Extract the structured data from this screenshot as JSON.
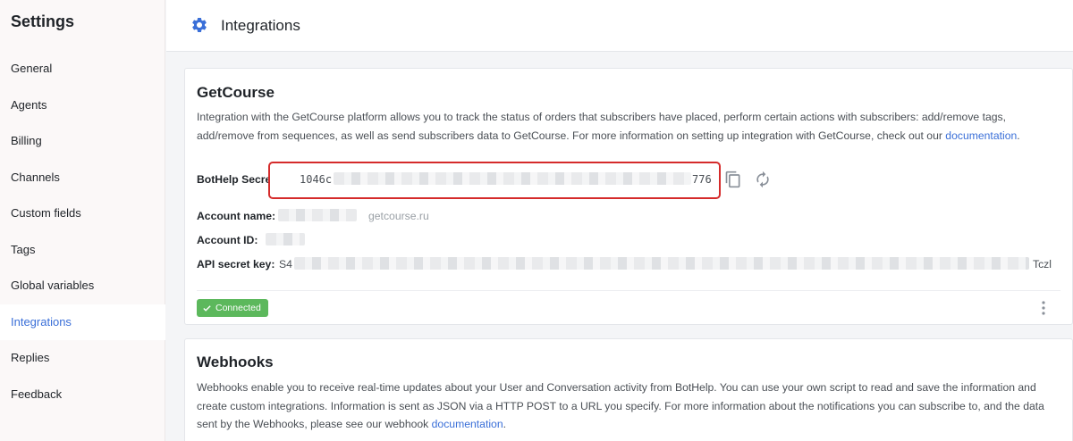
{
  "sidebar": {
    "title": "Settings",
    "items": [
      {
        "label": "General",
        "active": false
      },
      {
        "label": "Agents",
        "active": false
      },
      {
        "label": "Billing",
        "active": false
      },
      {
        "label": "Channels",
        "active": false
      },
      {
        "label": "Custom fields",
        "active": false
      },
      {
        "label": "Tags",
        "active": false
      },
      {
        "label": "Global variables",
        "active": false
      },
      {
        "label": "Integrations",
        "active": true
      },
      {
        "label": "Replies",
        "active": false
      },
      {
        "label": "Feedback",
        "active": false
      }
    ]
  },
  "header": {
    "title": "Integrations",
    "icon": "gear-icon"
  },
  "getcourse": {
    "title": "GetCourse",
    "description": "Integration with the GetCourse platform allows you to track the status of orders that subscribers have placed, perform certain actions with subscribers: add/remove tags, add/remove from sequences, as well as send subscribers data to GetCourse. For more information on setting up integration with GetCourse, check out our ",
    "description_link": "documentation",
    "description_end": ".",
    "secret_key_label": "BotHelp SecretKey:",
    "secret_key_prefix": "1046c",
    "secret_key_suffix": "776",
    "account_name_label": "Account name:",
    "account_name_domain": "getcourse.ru",
    "account_id_label": "Account ID:",
    "api_secret_label": "API secret key:",
    "api_secret_prefix": "S4",
    "api_secret_suffix": "Tczl",
    "status": "Connected"
  },
  "webhooks": {
    "title": "Webhooks",
    "description": "Webhooks enable you to receive real-time updates about your User and Conversation activity from BotHelp. You can use your own script to read and save the information and create custom integrations. Information is sent as JSON via a HTTP POST to a URL you specify. For more information about the notifications you can subscribe to, and the data sent by the Webhooks, please see our webhook ",
    "description_link": "documentation",
    "description_end": "."
  },
  "colors": {
    "accent": "#3a6fd8",
    "highlight_border": "#d52b2b",
    "connected": "#5cb85c"
  }
}
